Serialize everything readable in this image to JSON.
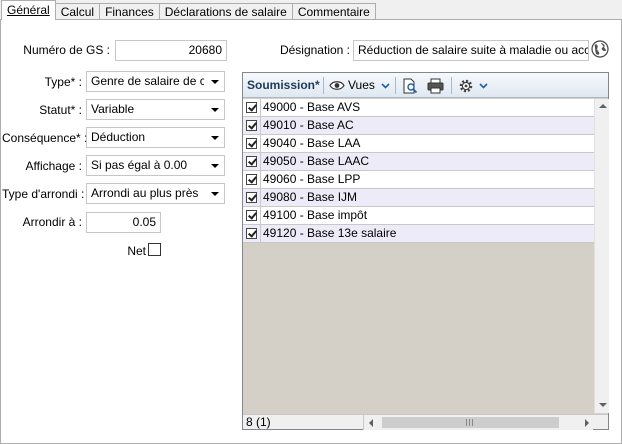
{
  "tabs": [
    "Général",
    "Calcul",
    "Finances",
    "Déclarations de salaire",
    "Commentaire"
  ],
  "form": {
    "numero_label": "Numéro de GS :",
    "numero_value": "20680",
    "type_label": "Type* :",
    "type_value": "Genre de salaire de calc",
    "statut_label": "Statut* :",
    "statut_value": "Variable",
    "consequence_label": "Conséquence* :",
    "consequence_value": "Déduction",
    "affichage_label": "Affichage :",
    "affichage_value": "Si pas égal à 0.00",
    "arrondi_type_label": "Type d'arrondi :",
    "arrondi_type_value": "Arrondi au plus près",
    "arrondir_label": "Arrondir à :",
    "arrondir_value": "0.05",
    "net_label": "Net",
    "designation_label": "Désignation :",
    "designation_value": "Réduction de salaire suite à maladie ou accident"
  },
  "grid": {
    "toolbar": {
      "soumission_label": "Soumission*",
      "vues_label": "Vues"
    },
    "rows": [
      "49000 - Base AVS",
      "49010 - Base AC",
      "49040 - Base LAA",
      "49050 - Base LAAC",
      "49060 - Base LPP",
      "49080 - Base IJM",
      "49100 - Base impôt",
      "49120 - Base 13e salaire"
    ],
    "status": "8 (1)"
  },
  "icons": {
    "globe": "globe-icon",
    "eye": "eye-icon",
    "preview": "print-preview-icon",
    "print": "printer-icon",
    "gear": "gear-icon"
  }
}
